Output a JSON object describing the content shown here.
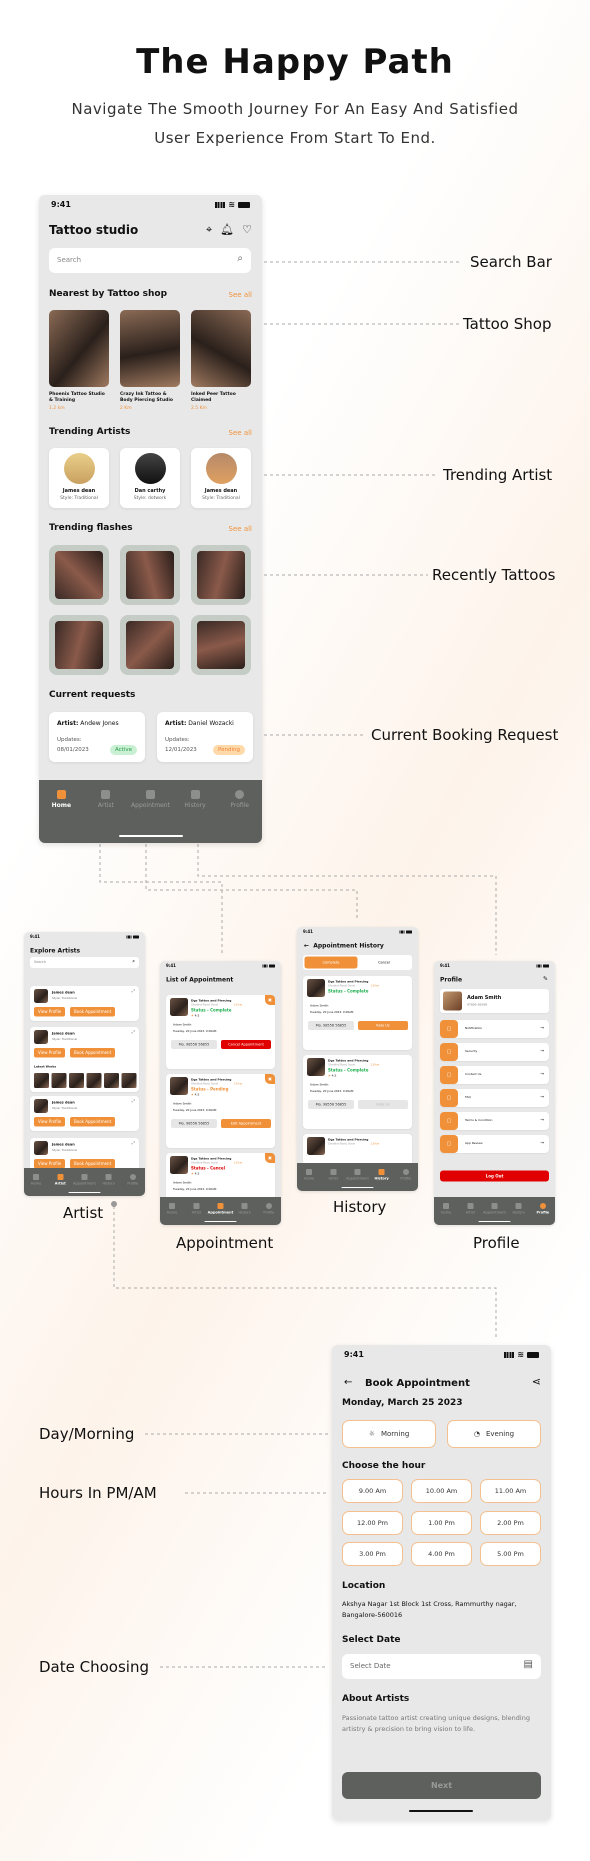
{
  "header": {
    "title": "The Happy Path",
    "subtitle_line1": "Navigate The Smooth Journey For An Easy And Satisfied",
    "subtitle_line2": "User Experience From Start To End."
  },
  "colors": {
    "accent": "#f0913a",
    "nav_bg": "#5d605d",
    "screen_bg": "#e8e8e8",
    "success": "#1fae4f",
    "danger": "#e00000"
  },
  "annotations": {
    "search_bar": "Search Bar",
    "tattoo_shop": "Tattoo Shop",
    "trending_artist": "Trending Artist",
    "recently_tattoos": "Recently Tattoos",
    "current_booking": "Current Booking Request",
    "day_morning": "Day/Morning",
    "hours": "Hours In PM/AM",
    "date_choosing": "Date Choosing"
  },
  "screen_labels": {
    "artist": "Artist",
    "appointment": "Appointment",
    "history": "History",
    "profile": "Profile"
  },
  "home": {
    "status_time": "9:41",
    "title": "Tattoo studio",
    "search_placeholder": "Search",
    "nearest_title": "Nearest by Tattoo shop",
    "see_all": "See all",
    "shops": [
      {
        "name": "Phoenix Tattoo Studio & Training",
        "distance": "1.2 km"
      },
      {
        "name": "Crazy Ink Tattoo & Body Piercing Studio",
        "distance": "2 Km"
      },
      {
        "name": "Inked Peer Tattoo Claimed",
        "distance": "2.5 Km"
      }
    ],
    "artists_title": "Trending Artists",
    "artists": [
      {
        "name": "James dean",
        "style": "Style: Traditional"
      },
      {
        "name": "Dan carthy",
        "style": "Style: dotwork"
      },
      {
        "name": "James dean",
        "style": "Style: Traditional"
      }
    ],
    "flashes_title": "Trending flashes",
    "requests_title": "Current requests",
    "requests": [
      {
        "artist_label": "Artist:",
        "artist": "Andew Jones",
        "updates_label": "Updates:",
        "date": "08/01/2023",
        "status": "Active"
      },
      {
        "artist_label": "Artist:",
        "artist": "Daniel Wozacki",
        "updates_label": "Updates:",
        "date": "12/01/2023",
        "status": "Pending"
      }
    ]
  },
  "nav": [
    "Home",
    "Artist",
    "Appointment",
    "History",
    "Profile"
  ],
  "artist_screen": {
    "status_time": "9:41",
    "title": "Explore Artists",
    "search_placeholder": "Search",
    "name": "James dean",
    "style": "Style: Traditional",
    "view_profile": "View Profile",
    "book": "Book Appointment",
    "latest_works": "Latest Works"
  },
  "appointment_screen": {
    "status_time": "9:41",
    "title": "List of Appointment",
    "shop": "Dgs Tattoo and Piercing",
    "address": "Ghoddod Road, Surat",
    "distance": "1.8 km",
    "rating": "4.5",
    "customer": "Adam Smith",
    "datetime": "Tuesday, 20 June 2023, 9:00AM",
    "mobile": "Mo. 98556 56855",
    "items": [
      {
        "status": "Status - Complete",
        "action": "Cancel Appointment"
      },
      {
        "status": "Status - Pending",
        "action": "Edit Appointment"
      },
      {
        "status": "Status - Cancel",
        "action": ""
      }
    ]
  },
  "history_screen": {
    "status_time": "9:41",
    "title": "Appointment History",
    "tab_complete": "Complete",
    "tab_cancel": "Cancel",
    "shop": "Dgs Tattoo and Piercing",
    "address": "Ghoddod Road, Surat",
    "distance": "1.8 km",
    "status": "Status - Complete",
    "rating": "4.5",
    "customer": "Adam Smith",
    "datetime": "Tuesday, 20 June 2023, 9:00AM",
    "mobile": "Mo. 98556 56855",
    "rate": "Rate Us"
  },
  "profile_screen": {
    "status_time": "9:41",
    "title": "Profile",
    "name": "Adam Smith",
    "phone": "97809 36598",
    "menu": [
      "Notification",
      "Security",
      "Contact Us",
      "FAQ",
      "Terms & Condition",
      "App Review"
    ],
    "logout": "Log Out"
  },
  "booking": {
    "status_time": "9:41",
    "title": "Book Appointment",
    "date": "Monday, March 25 2023",
    "morning": "Morning",
    "evening": "Evening",
    "choose_hour": "Choose the hour",
    "hours": [
      "9.00 Am",
      "10.00 Am",
      "11.00 Am",
      "12.00 Pm",
      "1.00 Pm",
      "2.00 Pm",
      "3.00 Pm",
      "4.00 Pm",
      "5.00 Pm"
    ],
    "location_title": "Location",
    "location": "Akshya Nagar 1st Block 1st Cross, Rammurthy nagar, Bangalore-560016",
    "select_date_title": "Select Date",
    "select_date_placeholder": "Select Date",
    "about_title": "About Artists",
    "about": "Passionate tattoo artist creating unique designs, blending artistry & precision to bring vision to life.",
    "next": "Next"
  }
}
